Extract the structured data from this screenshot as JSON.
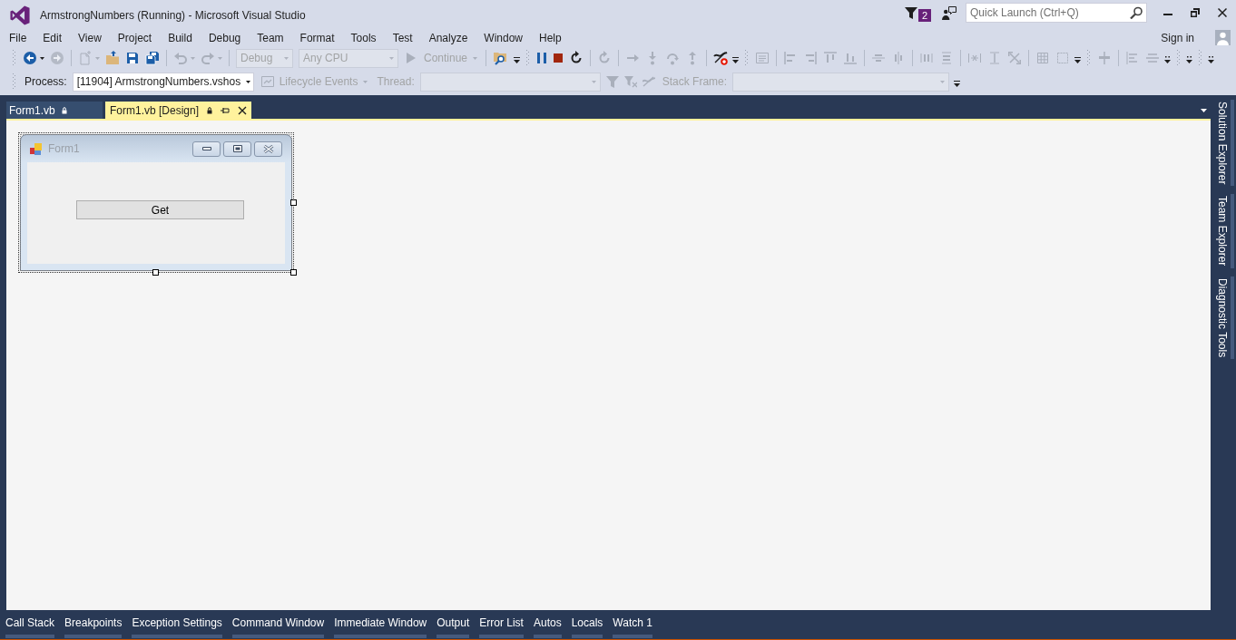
{
  "window": {
    "title": "ArmstrongNumbers (Running) - Microsoft Visual Studio"
  },
  "title_bar": {
    "notification_count": "2",
    "quick_launch": {
      "placeholder": "Quick Launch (Ctrl+Q)"
    }
  },
  "menu": [
    "File",
    "Edit",
    "View",
    "Project",
    "Build",
    "Debug",
    "Team",
    "Format",
    "Tools",
    "Test",
    "Analyze",
    "Window",
    "Help"
  ],
  "account": {
    "label": "Sign in"
  },
  "standard_toolbar": {
    "configuration": {
      "value": "Debug",
      "disabled": true
    },
    "platform": {
      "value": "Any CPU",
      "disabled": true
    },
    "continue_button": {
      "label": "Continue",
      "disabled": true
    }
  },
  "debug_location_toolbar": {
    "process": {
      "label": "Process:",
      "value": "[11904] ArmstrongNumbers.vshos",
      "disabled": false
    },
    "lifecycle_events": {
      "label": "Lifecycle Events",
      "disabled": true
    },
    "thread": {
      "label": "Thread:",
      "disabled": true
    },
    "stack_frame": {
      "label": "Stack Frame:",
      "disabled": true
    }
  },
  "document_tabs": [
    {
      "label": "Form1.vb",
      "selected": false
    },
    {
      "label": "Form1.vb [Design]",
      "selected": true
    }
  ],
  "designer": {
    "form": {
      "title": "Form1",
      "selected": true,
      "button": {
        "label": "Get"
      }
    }
  },
  "side_tabs": [
    "Solution Explorer",
    "Team Explorer",
    "Diagnostic Tools"
  ],
  "tool_window_tabs": [
    "Call Stack",
    "Breakpoints",
    "Exception Settings",
    "Command Window",
    "Immediate Window",
    "Output",
    "Error List",
    "Autos",
    "Locals",
    "Watch 1"
  ]
}
